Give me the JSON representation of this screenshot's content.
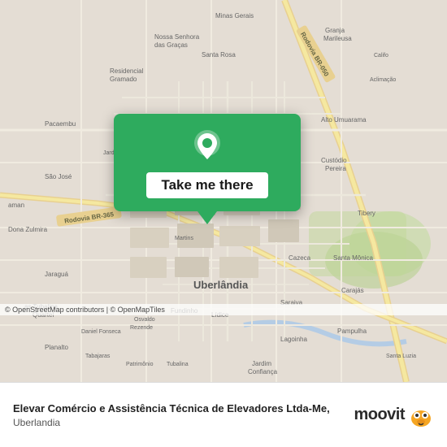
{
  "map": {
    "alt": "Map of Uberlândia area",
    "attribution": "© OpenStreetMap contributors | © OpenMapTiles",
    "background_color": "#e4ddd4"
  },
  "popup": {
    "button_label": "Take me there",
    "pin_color": "white"
  },
  "bottom_bar": {
    "title": "Elevar Comércio e Assistência Técnica de Elevadores Ltda-Me,",
    "subtitle": "Uberlandia",
    "logo_text": "moovit"
  }
}
